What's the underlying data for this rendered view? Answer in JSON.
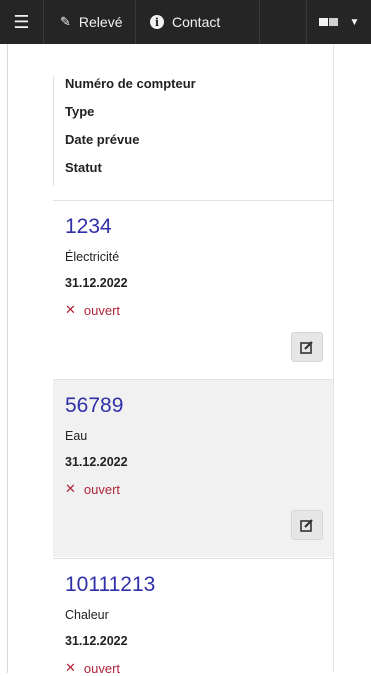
{
  "navbar": {
    "menu_icon": "hamburger-icon",
    "releve": {
      "icon": "pencil-icon",
      "label": "Relevé"
    },
    "contact": {
      "icon": "info-icon",
      "label": "Contact"
    },
    "language": {
      "icon": "language-icon",
      "caret_icon": "caret-down-icon"
    }
  },
  "header": {
    "fields": [
      "Numéro de compteur",
      "Type",
      "Date prévue",
      "Statut"
    ]
  },
  "meters": [
    {
      "number": "1234",
      "type": "Électricité",
      "date": "31.12.2022",
      "status": "ouvert",
      "status_icon": "x-icon",
      "status_color": "#b0263a",
      "edit_icon": "edit-icon"
    },
    {
      "number": "56789",
      "type": "Eau",
      "date": "31.12.2022",
      "status": "ouvert",
      "status_icon": "x-icon",
      "status_color": "#b0263a",
      "edit_icon": "edit-icon"
    },
    {
      "number": "10111213",
      "type": "Chaleur",
      "date": "31.12.2022",
      "status": "ouvert",
      "status_icon": "x-icon",
      "status_color": "#b0263a"
    }
  ],
  "colors": {
    "navbar": "#252525",
    "number_link": "#3030a8",
    "alt_card": "#f1f1f1"
  }
}
